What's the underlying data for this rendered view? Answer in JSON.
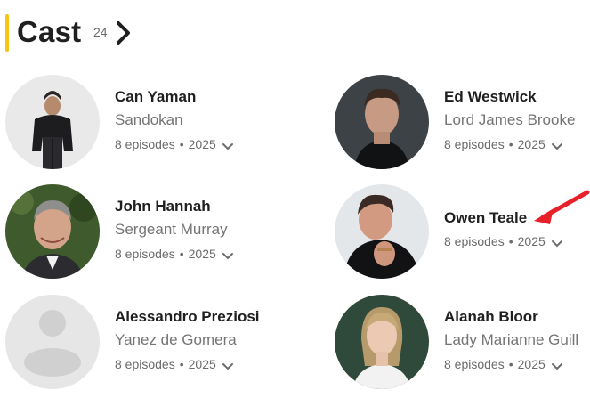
{
  "section": {
    "title": "Cast",
    "count": "24",
    "accent_color": "#f5c518"
  },
  "cast": [
    {
      "name": "Can Yaman",
      "role": "Sandokan",
      "episodes": "8 episodes",
      "year": "2025"
    },
    {
      "name": "Ed Westwick",
      "role": "Lord James Brooke",
      "episodes": "8 episodes",
      "year": "2025"
    },
    {
      "name": "John Hannah",
      "role": "Sergeant Murray",
      "episodes": "8 episodes",
      "year": "2025"
    },
    {
      "name": "Owen Teale",
      "role": "",
      "episodes": "8 episodes",
      "year": "2025"
    },
    {
      "name": "Alessandro Preziosi",
      "role": "Yanez de Gomera",
      "episodes": "8 episodes",
      "year": "2025"
    },
    {
      "name": "Alanah Bloor",
      "role": "Lady Marianne Guill",
      "episodes": "8 episodes",
      "year": "2025"
    }
  ],
  "separator": "•",
  "annotation": {
    "arrow_color": "#e8202a"
  }
}
